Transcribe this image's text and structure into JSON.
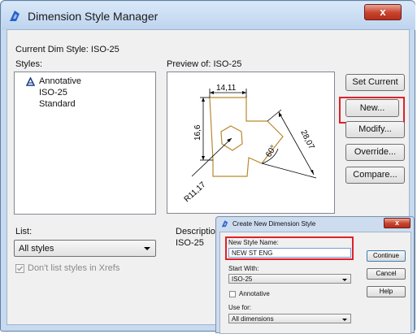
{
  "window": {
    "title": "Dimension Style Manager",
    "close_glyph": "x"
  },
  "current_style": {
    "label": "Current Dim Style:",
    "value": "ISO-25"
  },
  "styles": {
    "label": "Styles:",
    "items": [
      "Annotative",
      "ISO-25",
      "Standard"
    ]
  },
  "preview": {
    "label": "Preview of: ISO-25",
    "dims": {
      "top": "14,11",
      "left": "16,6",
      "diag": "28,07",
      "angle": "60°",
      "radius": "R11,17"
    }
  },
  "buttons": {
    "set_current": "Set Current",
    "new": "New...",
    "modify": "Modify...",
    "override": "Override...",
    "compare": "Compare..."
  },
  "list": {
    "label": "List:",
    "value": "All styles"
  },
  "xrefs_checkbox": {
    "label": "Don't list styles in Xrefs"
  },
  "description": {
    "label": "Description",
    "value": "ISO-25"
  },
  "new_dialog": {
    "title": "Create New Dimension Style",
    "close_glyph": "x",
    "name_label": "New Style Name:",
    "name_value": "NEW ST ENG",
    "start_label": "Start With:",
    "start_value": "ISO-25",
    "annotative_label": "Annotative",
    "use_label": "Use for:",
    "use_value": "All dimensions",
    "continue": "Continue",
    "cancel": "Cancel",
    "help": "Help"
  },
  "colors": {
    "highlight": "#e0202a",
    "drawing": "#b8892f",
    "dimension": "#000000"
  }
}
